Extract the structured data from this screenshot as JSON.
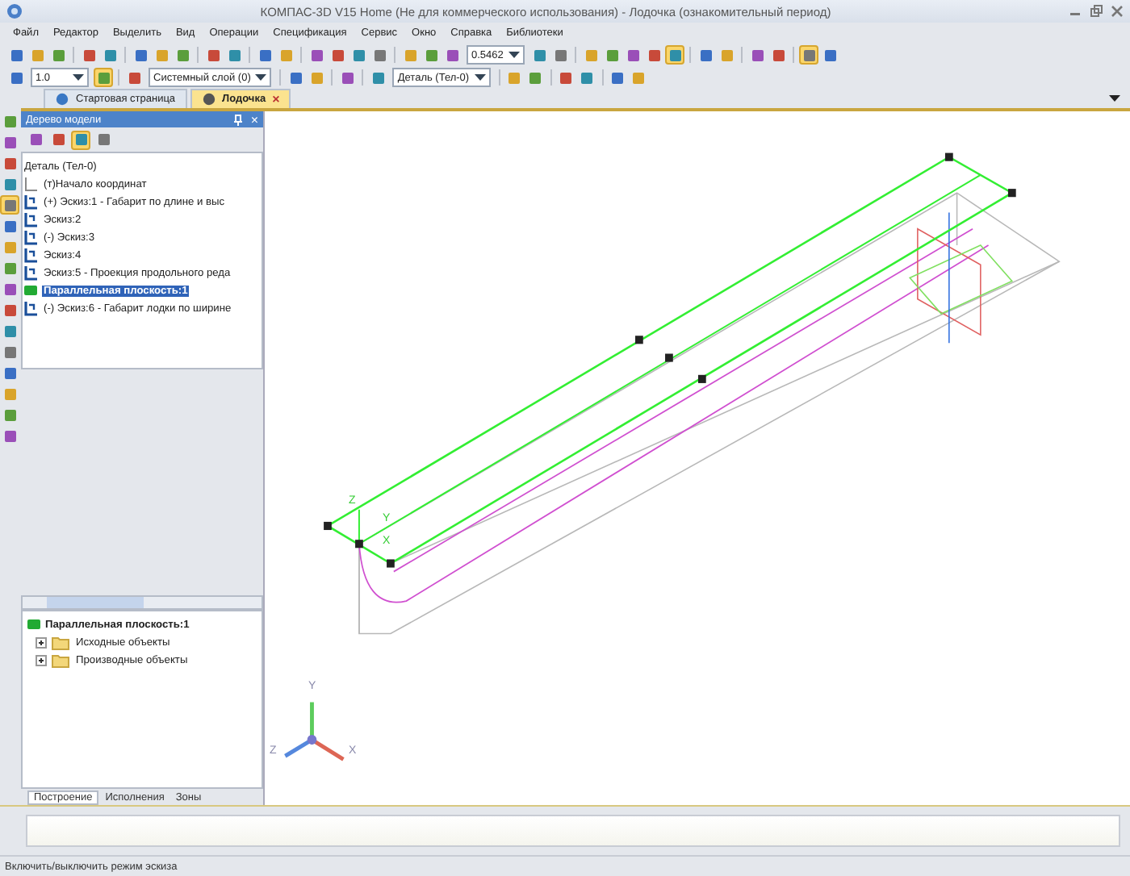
{
  "window": {
    "title": "КОМПАС-3D V15 Home (Не для коммерческого использования) - Лодочка (ознакомительный период)"
  },
  "menu": [
    "Файл",
    "Редактор",
    "Выделить",
    "Вид",
    "Операции",
    "Спецификация",
    "Сервис",
    "Окно",
    "Справка",
    "Библиотеки"
  ],
  "toolbar_1": [
    {
      "kind": "icon",
      "pressed": false
    },
    {
      "kind": "icon",
      "pressed": false
    },
    {
      "kind": "icon",
      "pressed": false
    },
    {
      "kind": "sep"
    },
    {
      "kind": "icon",
      "pressed": false
    },
    {
      "kind": "icon",
      "pressed": false
    },
    {
      "kind": "sep"
    },
    {
      "kind": "icon",
      "pressed": false
    },
    {
      "kind": "icon",
      "pressed": false
    },
    {
      "kind": "icon",
      "pressed": false
    },
    {
      "kind": "sep"
    },
    {
      "kind": "icon",
      "pressed": false
    },
    {
      "kind": "icon",
      "pressed": false
    },
    {
      "kind": "sep"
    },
    {
      "kind": "icon",
      "pressed": false
    },
    {
      "kind": "icon",
      "pressed": false
    },
    {
      "kind": "sep"
    },
    {
      "kind": "icon",
      "pressed": false
    },
    {
      "kind": "icon",
      "pressed": false
    },
    {
      "kind": "icon",
      "pressed": false
    },
    {
      "kind": "icon",
      "pressed": false
    },
    {
      "kind": "sep"
    },
    {
      "kind": "icon",
      "pressed": false
    },
    {
      "kind": "icon",
      "pressed": false
    },
    {
      "kind": "icon",
      "pressed": false
    },
    {
      "kind": "combo",
      "value": "0.5462"
    },
    {
      "kind": "icon",
      "pressed": false
    },
    {
      "kind": "icon",
      "pressed": false
    },
    {
      "kind": "sep"
    },
    {
      "kind": "icon",
      "pressed": false
    },
    {
      "kind": "icon",
      "pressed": false
    },
    {
      "kind": "icon",
      "pressed": false
    },
    {
      "kind": "icon",
      "pressed": false
    },
    {
      "kind": "icon",
      "pressed": true
    },
    {
      "kind": "sep"
    },
    {
      "kind": "icon",
      "pressed": false
    },
    {
      "kind": "icon",
      "pressed": false
    },
    {
      "kind": "sep"
    },
    {
      "kind": "icon",
      "pressed": false
    },
    {
      "kind": "icon",
      "pressed": false
    },
    {
      "kind": "sep"
    },
    {
      "kind": "icon",
      "pressed": true
    },
    {
      "kind": "icon",
      "pressed": false
    }
  ],
  "toolbar_2": [
    {
      "kind": "icon",
      "pressed": false
    },
    {
      "kind": "combo",
      "value": "1.0"
    },
    {
      "kind": "icon",
      "pressed": true
    },
    {
      "kind": "sep"
    },
    {
      "kind": "icon",
      "pressed": false
    },
    {
      "kind": "combo",
      "value": "Системный слой (0)"
    },
    {
      "kind": "sep"
    },
    {
      "kind": "icon",
      "pressed": false
    },
    {
      "kind": "icon",
      "pressed": false
    },
    {
      "kind": "sep"
    },
    {
      "kind": "icon",
      "pressed": false
    },
    {
      "kind": "sep"
    },
    {
      "kind": "icon",
      "pressed": false
    },
    {
      "kind": "combo",
      "value": "Деталь (Тел-0)"
    },
    {
      "kind": "sep"
    },
    {
      "kind": "icon",
      "pressed": false
    },
    {
      "kind": "icon",
      "pressed": false
    },
    {
      "kind": "sep"
    },
    {
      "kind": "icon",
      "pressed": false
    },
    {
      "kind": "icon",
      "pressed": false
    },
    {
      "kind": "sep"
    },
    {
      "kind": "icon",
      "pressed": false
    },
    {
      "kind": "icon",
      "pressed": false
    }
  ],
  "side_toolbar": [
    {
      "pressed": false
    },
    {
      "pressed": false
    },
    {
      "pressed": false
    },
    {
      "pressed": false
    },
    {
      "pressed": true
    },
    {
      "pressed": false
    },
    {
      "pressed": false
    },
    {
      "pressed": false
    },
    {
      "pressed": false
    },
    {
      "pressed": false
    },
    {
      "pressed": false
    },
    {
      "pressed": false
    },
    {
      "pressed": false
    },
    {
      "pressed": false
    },
    {
      "pressed": false
    },
    {
      "pressed": false
    }
  ],
  "tabs": [
    {
      "label": "Стартовая страница",
      "selected": false
    },
    {
      "label": "Лодочка",
      "selected": true,
      "close": "×"
    }
  ],
  "model_tree": {
    "title": "Дерево модели",
    "close": "×",
    "tools": [
      {
        "pressed": false
      },
      {
        "pressed": false
      },
      {
        "pressed": true
      },
      {
        "pressed": false
      }
    ],
    "items": [
      {
        "kind": "root",
        "label": "Деталь (Тел-0)",
        "selected": false
      },
      {
        "kind": "origin",
        "label": "(т)Начало координат",
        "selected": false
      },
      {
        "kind": "sketch",
        "label": "(+) Эскиз:1 - Габарит по длине и выс",
        "selected": false
      },
      {
        "kind": "sketch",
        "label": "Эскиз:2",
        "selected": false
      },
      {
        "kind": "sketch",
        "label": "(-) Эскиз:3",
        "selected": false
      },
      {
        "kind": "sketch",
        "label": "Эскиз:4",
        "selected": false
      },
      {
        "kind": "sketch",
        "label": "Эскиз:5 - Проекция продольного реда",
        "selected": false
      },
      {
        "kind": "plane",
        "label": "Параллельная плоскость:1",
        "selected": true
      },
      {
        "kind": "sketch",
        "label": "(-) Эскиз:6 - Габарит лодки по ширине",
        "selected": false
      }
    ]
  },
  "relations": {
    "title": "Параллельная плоскость:1",
    "children": [
      {
        "label": "Исходные объекты",
        "expanded": false
      },
      {
        "label": "Производные объекты",
        "expanded": false
      }
    ]
  },
  "panel_tabs": [
    {
      "label": "Построение",
      "selected": true
    },
    {
      "label": "Исполнения",
      "selected": false
    },
    {
      "label": "Зоны",
      "selected": false
    }
  ],
  "canvas": {
    "origin_labels": [
      "Z",
      "Y",
      "X"
    ],
    "triad_labels": [
      "Y",
      "Z",
      "X"
    ]
  },
  "status_bar": {
    "text": "Включить/выключить режим эскиза"
  }
}
